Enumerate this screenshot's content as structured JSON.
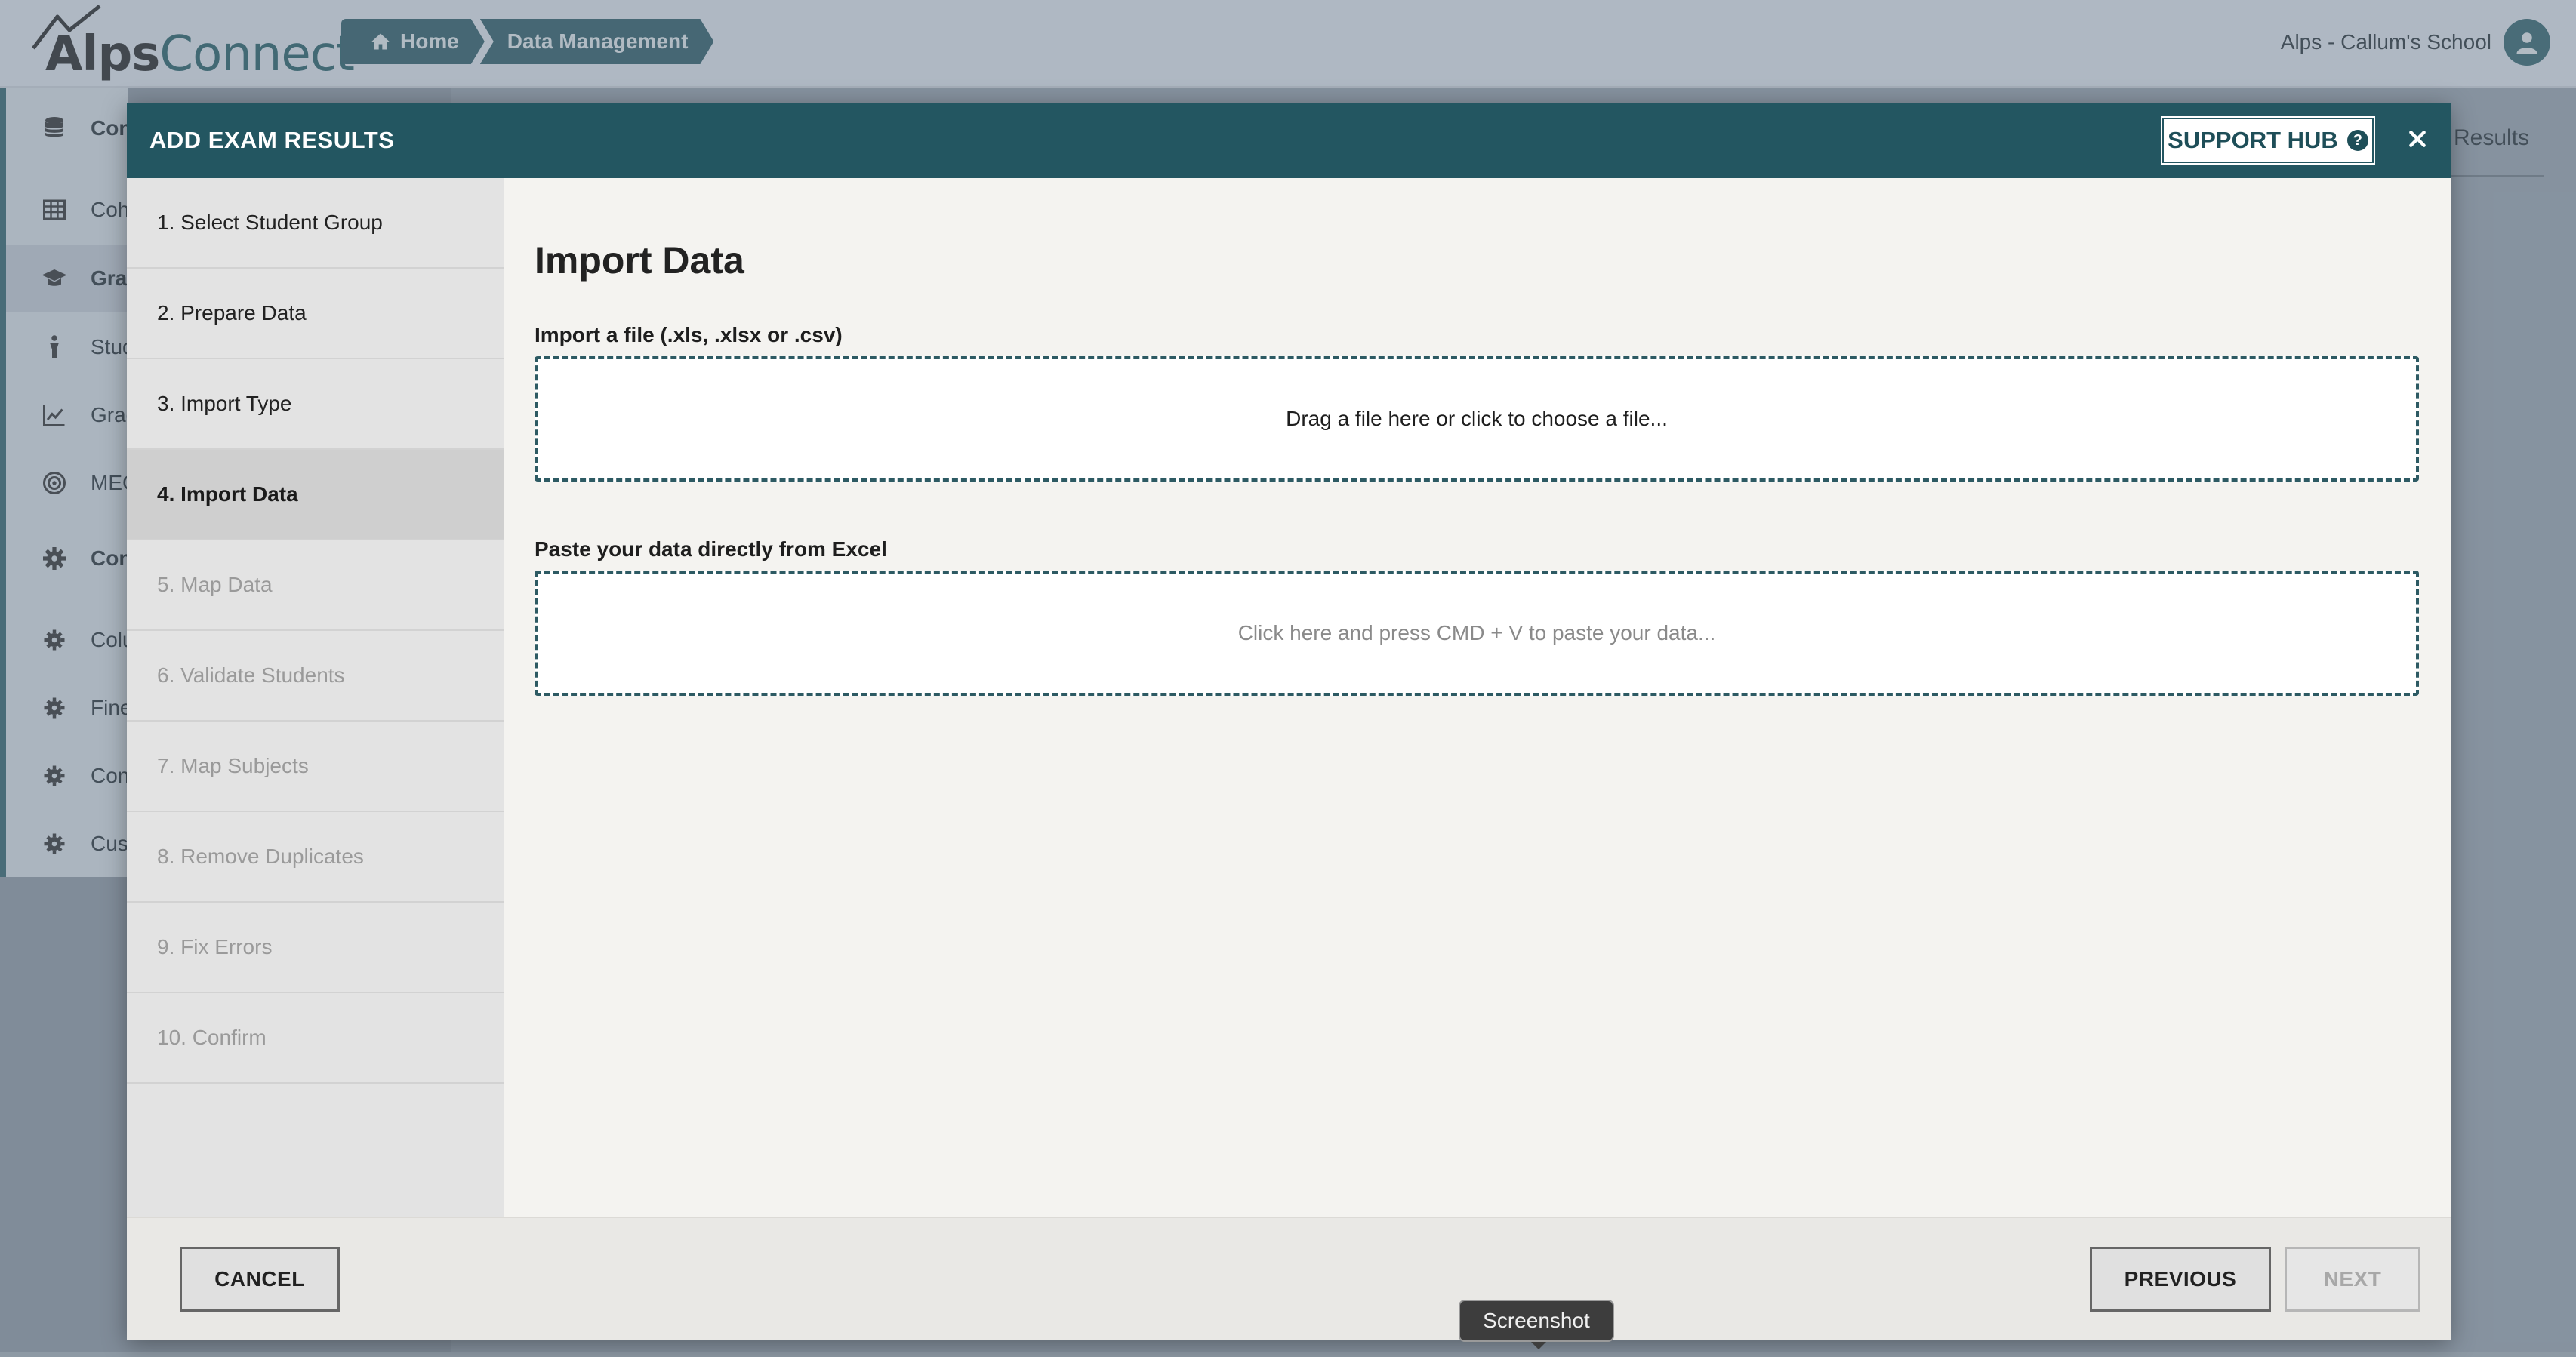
{
  "header": {
    "logo_text_a": "Alps",
    "logo_text_b": "Connect",
    "breadcrumbs": [
      {
        "label": "Home",
        "icon": "home-icon"
      },
      {
        "label": "Data Management"
      }
    ],
    "user_name": "Alps - Callum's School"
  },
  "sidebar": {
    "items": [
      {
        "label": "Con",
        "icon": "database-icon"
      },
      {
        "label": "Coh",
        "icon": "table-icon"
      },
      {
        "label": "Grad",
        "icon": "graduation-cap-icon"
      },
      {
        "label": "Stud",
        "icon": "student-icon"
      },
      {
        "label": "Grad",
        "icon": "line-chart-icon"
      },
      {
        "label": "MEG",
        "icon": "target-icon"
      },
      {
        "label": "Con",
        "icon": "gear-icon"
      },
      {
        "label": "Colu",
        "icon": "gear-icon"
      },
      {
        "label": "Fine",
        "icon": "gear-icon"
      },
      {
        "label": "Con",
        "icon": "gear-icon"
      },
      {
        "label": "Cust",
        "icon": "gear-icon"
      }
    ]
  },
  "background": {
    "results_tab": "Results"
  },
  "modal": {
    "title": "ADD EXAM RESULTS",
    "support_label": "SUPPORT HUB",
    "steps": [
      {
        "label": "1. Select Student Group",
        "state": "done"
      },
      {
        "label": "2. Prepare Data",
        "state": "done"
      },
      {
        "label": "3. Import Type",
        "state": "done"
      },
      {
        "label": "4. Import Data",
        "state": "active"
      },
      {
        "label": "5. Map Data",
        "state": "disabled"
      },
      {
        "label": "6. Validate Students",
        "state": "disabled"
      },
      {
        "label": "7. Map Subjects",
        "state": "disabled"
      },
      {
        "label": "8. Remove Duplicates",
        "state": "disabled"
      },
      {
        "label": "9. Fix Errors",
        "state": "disabled"
      },
      {
        "label": "10. Confirm",
        "state": "disabled"
      }
    ],
    "content": {
      "heading": "Import Data",
      "file_label": "Import a file (.xls, .xlsx or .csv)",
      "file_drop_text": "Drag a file here or click to choose a file...",
      "paste_label": "Paste your data directly from Excel",
      "paste_placeholder": "Click here and press CMD + V to paste your data..."
    },
    "footer": {
      "cancel": "CANCEL",
      "previous": "PREVIOUS",
      "next": "NEXT"
    }
  },
  "tooltip": "Screenshot",
  "colors": {
    "brand_teal": "#235661",
    "active_step_bg": "#cfcfcf",
    "disabled_text": "#9a9a9a"
  }
}
